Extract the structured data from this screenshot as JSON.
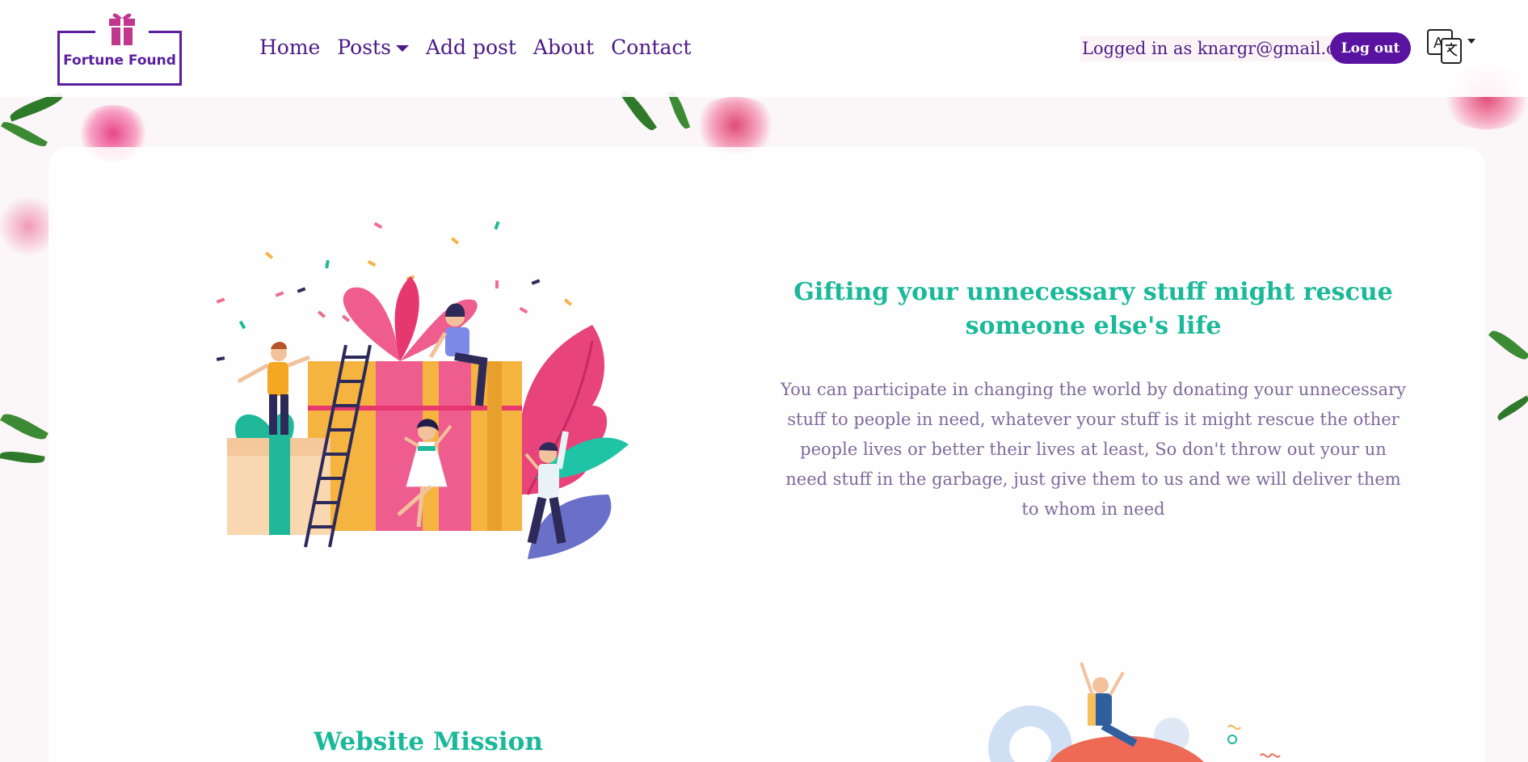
{
  "brand": {
    "name": "Fortune Found",
    "color": "#5a1e9e"
  },
  "nav": {
    "items": [
      {
        "label": "Home"
      },
      {
        "label": "Posts",
        "has_dropdown": true
      },
      {
        "label": "Add post"
      },
      {
        "label": "About"
      },
      {
        "label": "Contact"
      }
    ]
  },
  "session": {
    "logged_in_text": "Logged in as knargr@gmail.com",
    "logout_label": "Log out"
  },
  "language_switch": {
    "icon": "translate-icon"
  },
  "hero": {
    "title": "Gifting your unnecessary stuff might rescue someone else's life",
    "text": "You can participate in changing the world by donating your unnecessary stuff to people in need, whatever your stuff is it might rescue the other people lives or better their lives at least, So don't throw out your un need stuff in the garbage, just give them to us and we will deliver them to whom in need",
    "illustration": "gift-party-illustration"
  },
  "mission": {
    "title": "Website Mission",
    "illustration": "mission-illustration"
  },
  "colors": {
    "primary": "#5a12a1",
    "accent": "#19b999",
    "body_text": "#7d6a9c"
  }
}
